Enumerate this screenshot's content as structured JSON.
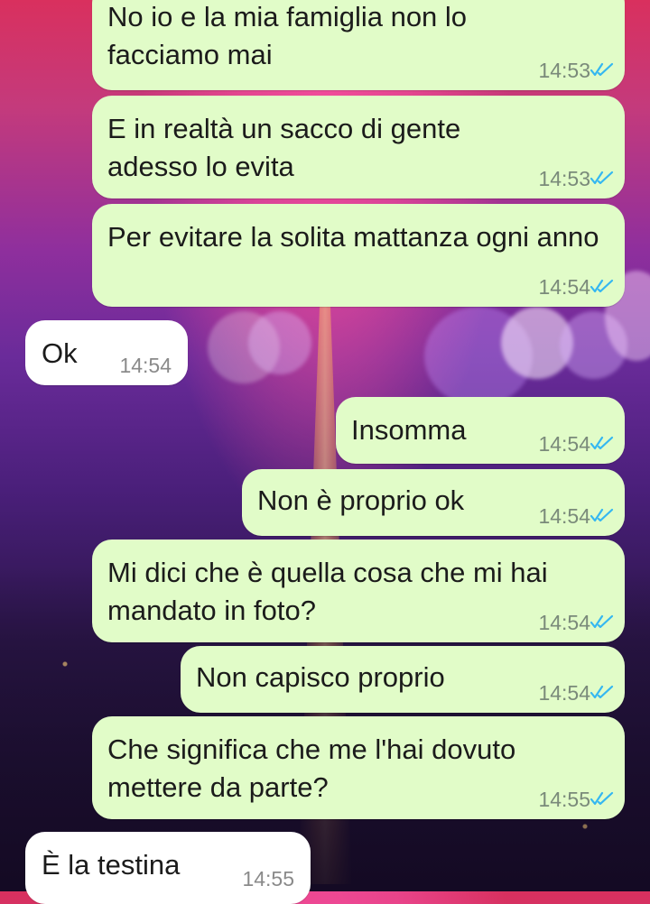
{
  "messages": [
    {
      "text": "No io e la mia famiglia non lo facciamo mai",
      "time": "14:53",
      "direction": "out"
    },
    {
      "text": "E in realtà un sacco di gente adesso lo evita",
      "time": "14:53",
      "direction": "out"
    },
    {
      "text": "Per evitare la solita mattanza ogni anno",
      "time": "14:54",
      "direction": "out"
    },
    {
      "text": "Ok",
      "time": "14:54",
      "direction": "in"
    },
    {
      "text": "Insomma",
      "time": "14:54",
      "direction": "out"
    },
    {
      "text": "Non è proprio ok",
      "time": "14:54",
      "direction": "out"
    },
    {
      "text": "Mi dici che è quella cosa che mi hai mandato in foto?",
      "time": "14:54",
      "direction": "out"
    },
    {
      "text": "Non capisco proprio",
      "time": "14:54",
      "direction": "out"
    },
    {
      "text": "Che significa che me l'hai dovuto mettere da parte?",
      "time": "14:55",
      "direction": "out"
    },
    {
      "text": "È la testina",
      "time": "14:55",
      "direction": "in"
    }
  ],
  "colors": {
    "outgoing_bubble": "#e1fcc8",
    "incoming_bubble": "#ffffff",
    "read_ticks": "#34b7f1"
  },
  "icons": {
    "read_receipt": "double-check-icon"
  }
}
